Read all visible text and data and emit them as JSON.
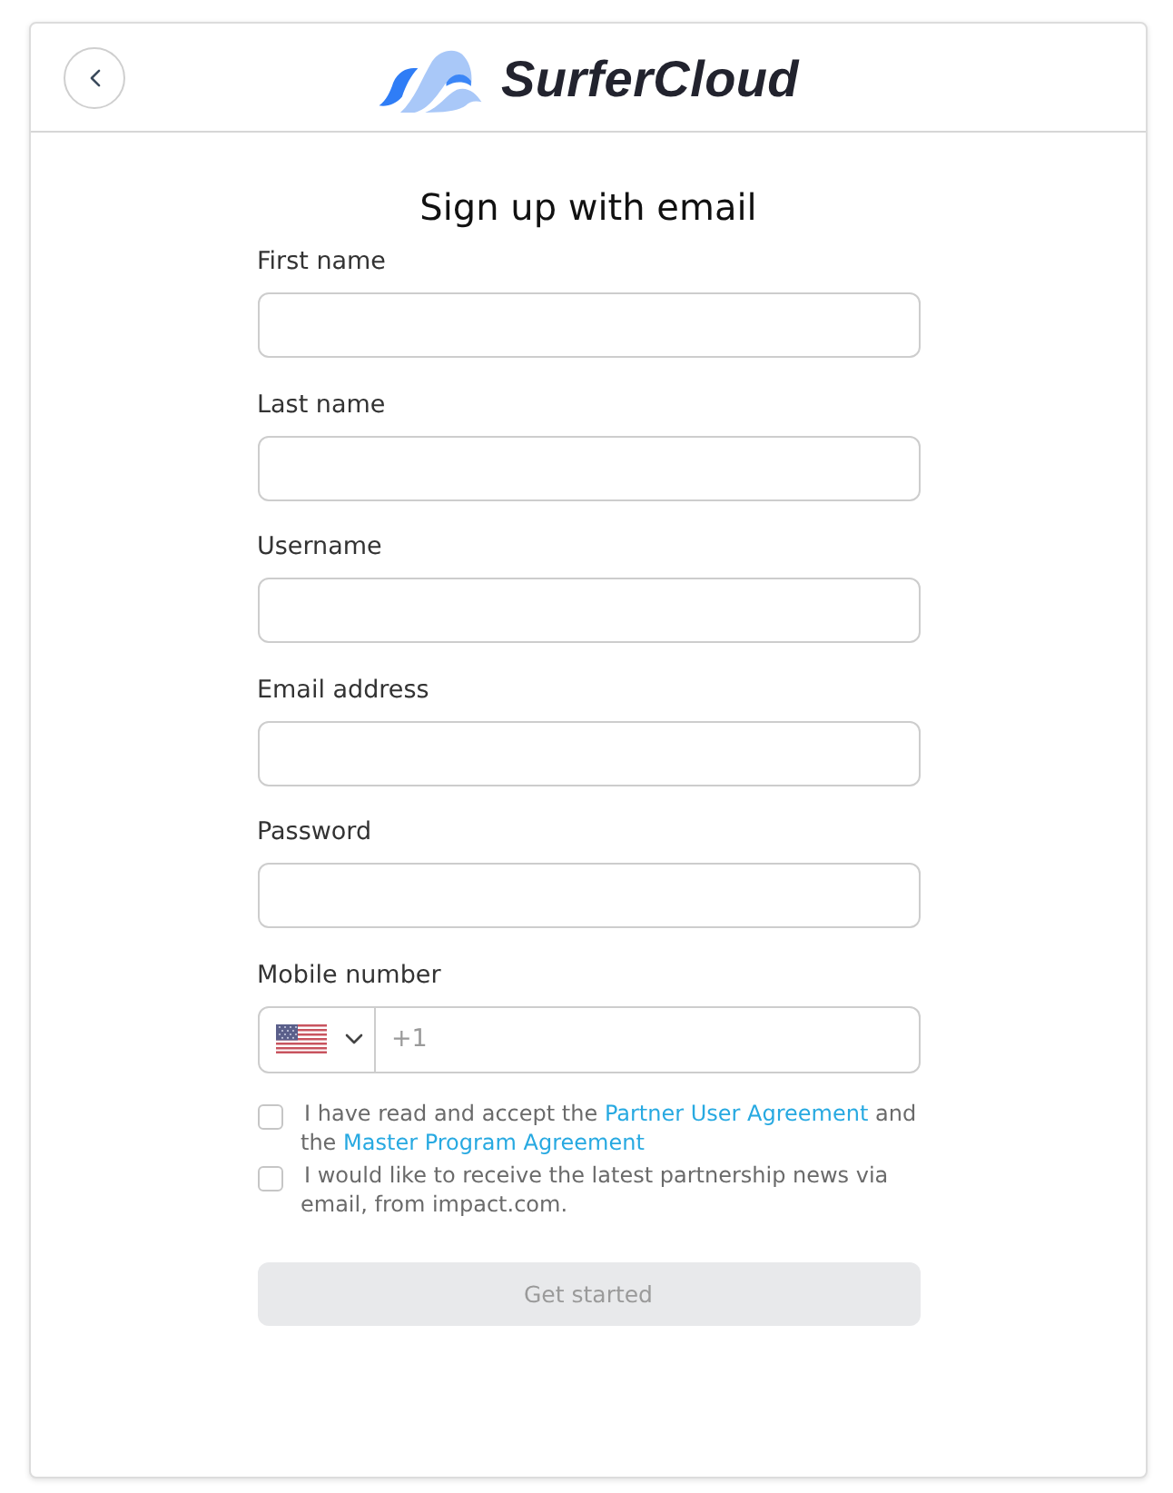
{
  "header": {
    "logo": {
      "text": "SurferCloud"
    }
  },
  "title": "Sign up with email",
  "fields": [
    {
      "kind": "text",
      "label": "First name"
    },
    {
      "kind": "text",
      "label": "Last name"
    },
    {
      "kind": "text",
      "label": "Username"
    },
    {
      "kind": "text",
      "label": "Email address"
    },
    {
      "kind": "text",
      "label": "Password"
    },
    {
      "kind": "phone",
      "label": "Mobile number",
      "placeholder": "+1"
    }
  ],
  "consents": [
    {
      "checked": false,
      "parts": [
        {
          "kind": "text",
          "text": "I have read and accept the"
        },
        {
          "kind": "link",
          "text": "Partner User Agreement"
        },
        {
          "kind": "text",
          "text": "and the"
        },
        {
          "kind": "link",
          "text": "Master Program Agreement"
        }
      ]
    },
    {
      "checked": false,
      "parts": [
        {
          "kind": "text",
          "text": "I would like to receive the latest partnership news via email, from impact.com."
        }
      ]
    }
  ],
  "submit": {
    "label": "Get started",
    "disabled": true
  }
}
